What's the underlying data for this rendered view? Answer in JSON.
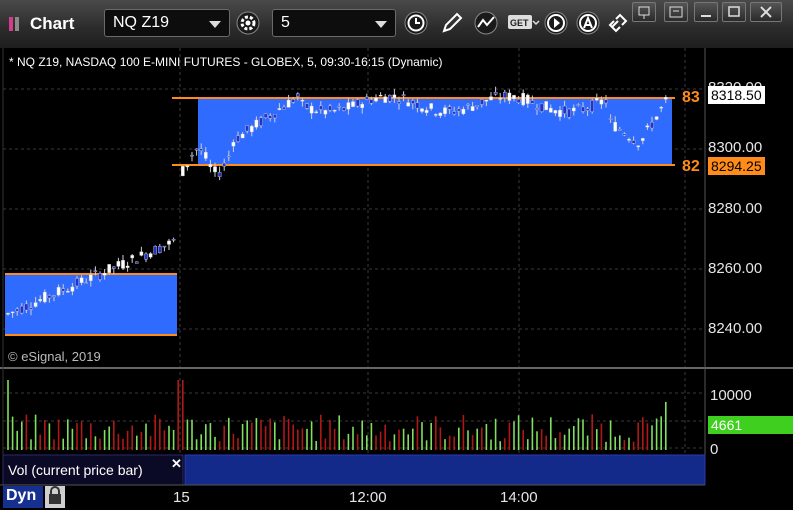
{
  "window": {
    "title": "Chart"
  },
  "toolbar": {
    "symbol": "NQ Z19",
    "interval": "5"
  },
  "chart": {
    "header": "* NQ Z19, NASDAQ 100 E-MINI FUTURES - GLOBEX, 5, 09:30-16:15 (Dynamic)",
    "copyright": "© eSignal, 2019",
    "price_axis": [
      "8320.00",
      "8300.00",
      "8280.00",
      "8260.00",
      "8240.00"
    ],
    "last_price": "8318.50",
    "level_83_price": "8294.25",
    "level_83_label": "83",
    "level_82_label": "82",
    "volume_axis": [
      "10000",
      "0"
    ],
    "volume_value": "4661",
    "volume_label": "Vol (current price bar)",
    "time_axis": [
      "15",
      "12:00",
      "14:00"
    ],
    "mode_label": "Dyn"
  },
  "colors": {
    "zone": "#2f6bff",
    "level_line": "#ff8c1a",
    "up_candle": "#ffffff",
    "down_candle": "#2233cc",
    "vol_up": "#7fe05f",
    "vol_down": "#b01818",
    "grid": "#3a3a3a"
  }
}
